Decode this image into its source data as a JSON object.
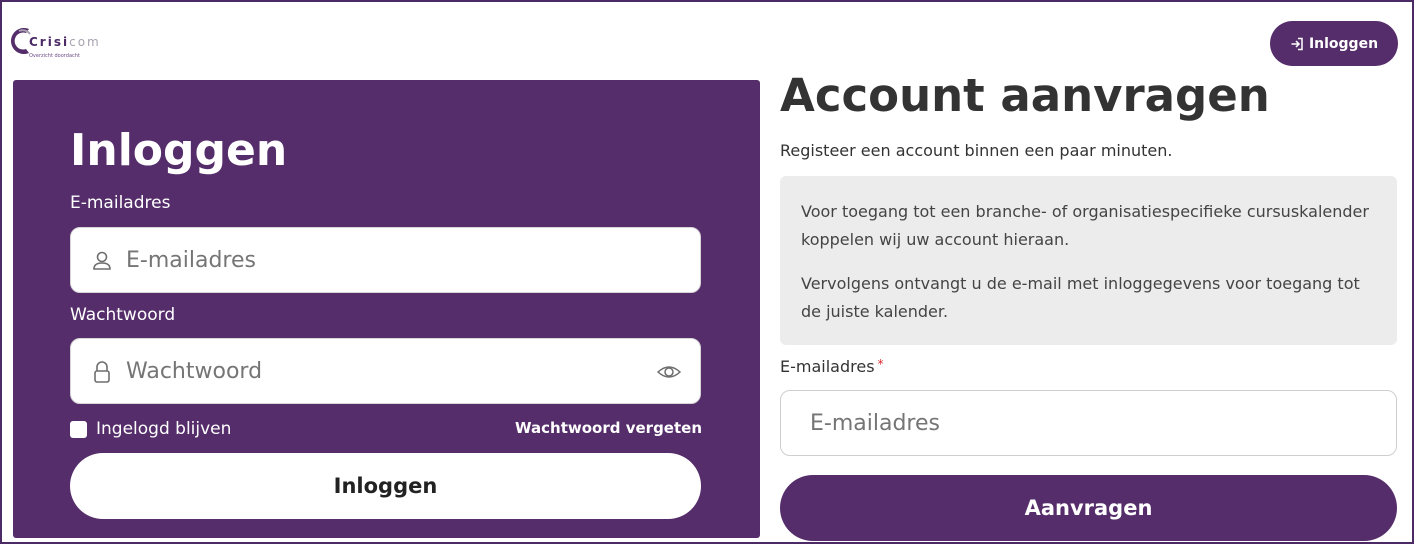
{
  "brand": {
    "name_bold": "Crisi",
    "name_light": "com",
    "tagline": "Overzicht doordacht",
    "accent_color": "#552d6b"
  },
  "header": {
    "login_label": "Inloggen",
    "login_icon": "sign-in-icon"
  },
  "login": {
    "title": "Inloggen",
    "email_label": "E-mailadres",
    "email_placeholder": "E-mailadres",
    "email_icon": "user-icon",
    "password_label": "Wachtwoord",
    "password_placeholder": "Wachtwoord",
    "password_icon": "lock-icon",
    "password_toggle_icon": "eye-icon",
    "remember_label": "Ingelogd blijven",
    "forgot_label": "Wachtwoord vergeten",
    "submit_label": "Inloggen"
  },
  "register": {
    "title": "Account aanvragen",
    "subtitle": "Registeer een account binnen een paar minuten.",
    "info_paragraph_1": "Voor toegang tot een branche- of organisatiespecifieke cursuskalender koppelen wij uw account hieraan.",
    "info_paragraph_2": "Vervolgens ontvangt u de e-mail met inloggegevens voor toegang tot de juiste kalender.",
    "email_label": "E-mailadres",
    "required_marker": "*",
    "email_placeholder": "E-mailadres",
    "submit_label": "Aanvragen"
  }
}
